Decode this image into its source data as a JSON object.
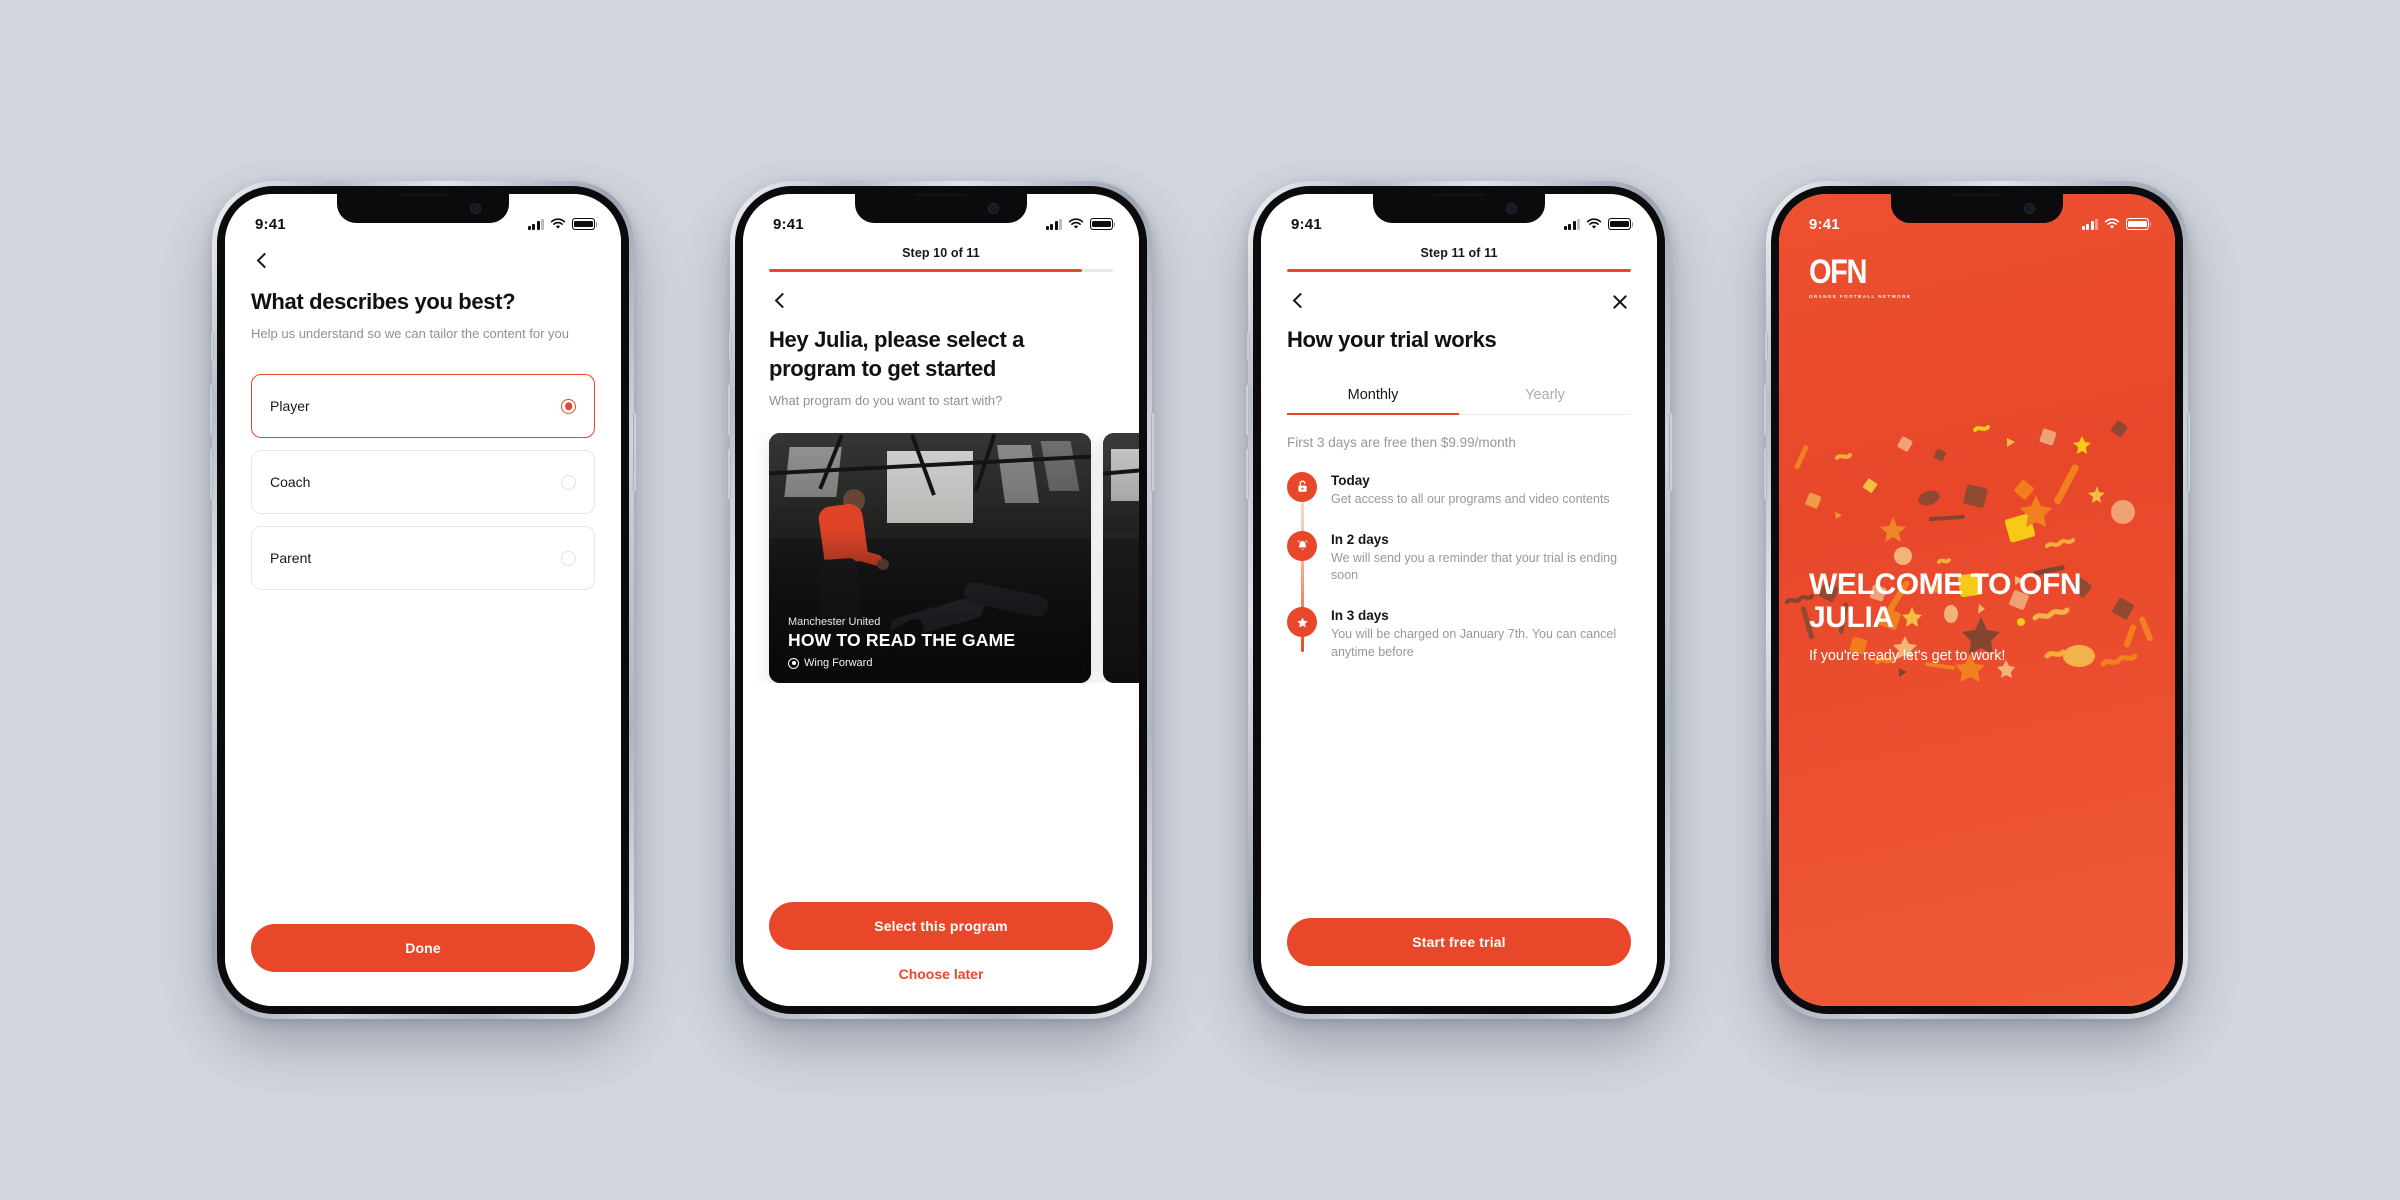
{
  "theme": {
    "accent": "#E8472A",
    "page_background": "#D2D6DE",
    "text_dark": "#101015",
    "text_muted": "#8C9099"
  },
  "phones": [
    {
      "name": "role-selection",
      "status_bar": {
        "time": "9:41",
        "icons": [
          "cellular-icon",
          "wifi-icon",
          "battery-icon"
        ]
      },
      "back_icon": "chevron-left-icon",
      "title": "What describes you best?",
      "subtitle": "Help us understand so we can tailor the content for you",
      "options": [
        {
          "label": "Player",
          "selected": true
        },
        {
          "label": "Coach",
          "selected": false
        },
        {
          "label": "Parent",
          "selected": false
        }
      ],
      "primary_button": "Done"
    },
    {
      "name": "program-selection",
      "status_bar": {
        "time": "9:41",
        "icons": [
          "cellular-icon",
          "wifi-icon",
          "battery-icon"
        ]
      },
      "step_label": "Step 10 of 11",
      "progress_percent": 91,
      "back_icon": "chevron-left-icon",
      "title": "Hey Julia, please select a program to get started",
      "subtitle": "What program do you want to start with?",
      "program_card": {
        "club": "Manchester United",
        "title": "HOW TO READ THE GAME",
        "position": "Wing Forward",
        "position_icon": "target-icon"
      },
      "primary_button": "Select this program",
      "secondary_button": "Choose later"
    },
    {
      "name": "trial-details",
      "status_bar": {
        "time": "9:41",
        "icons": [
          "cellular-icon",
          "wifi-icon",
          "battery-icon"
        ]
      },
      "step_label": "Step 11 of 11",
      "progress_percent": 100,
      "back_icon": "chevron-left-icon",
      "close_icon": "close-icon",
      "title": "How your trial works",
      "tabs": [
        {
          "label": "Monthly",
          "active": true
        },
        {
          "label": "Yearly",
          "active": false
        }
      ],
      "price_note": "First 3 days are free then $9.99/month",
      "timeline": [
        {
          "icon": "unlock-icon",
          "title": "Today",
          "desc": "Get access to all our programs and video contents"
        },
        {
          "icon": "bell-icon",
          "title": "In 2 days",
          "desc": "We will send you a reminder that your trial is ending soon"
        },
        {
          "icon": "star-icon",
          "title": "In 3 days",
          "desc": "You will be charged on January 7th. You can cancel anytime before"
        }
      ],
      "primary_button": "Start free trial"
    },
    {
      "name": "welcome",
      "status_bar": {
        "time": "9:41",
        "icons": [
          "cellular-icon",
          "wifi-icon",
          "battery-icon"
        ]
      },
      "logo": {
        "mark": "OFN",
        "tagline": "ORANGE FOOTBALL NETWORK"
      },
      "headline": "WELCOME TO OFN JULIA",
      "subline": "If you're ready let's get to work!"
    }
  ]
}
